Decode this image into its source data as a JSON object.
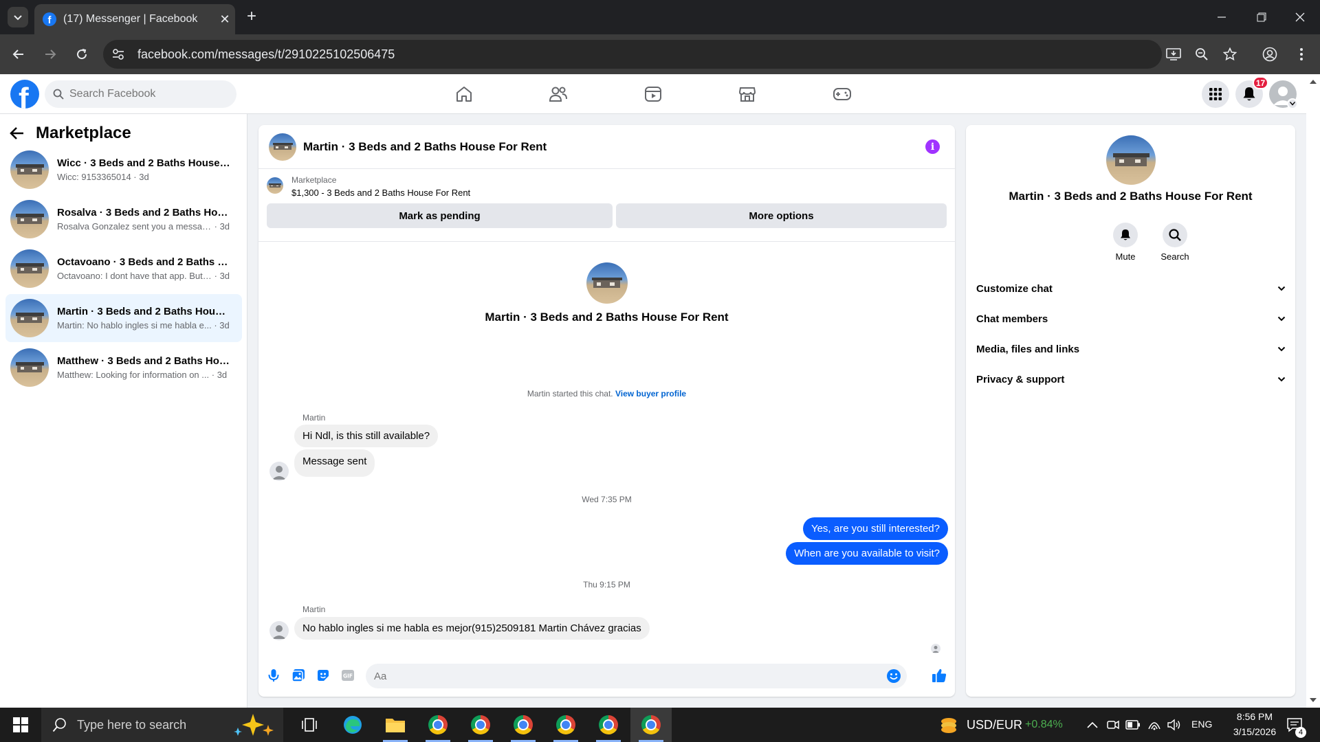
{
  "browser": {
    "tab_title": "(17) Messenger | Facebook",
    "url": "facebook.com/messages/t/2910225102506475"
  },
  "header": {
    "search_placeholder": "Search Facebook",
    "notification_count": "17"
  },
  "sidebar": {
    "title": "Marketplace",
    "conversations": [
      {
        "name": "Wicc · 3 Beds and 2 Baths House F...",
        "preview": "Wicc: 9153365014",
        "time": "3d",
        "active": false
      },
      {
        "name": "Rosalva · 3 Beds and 2 Baths Hous...",
        "preview": "Rosalva Gonzalez sent you a message...",
        "time": "3d",
        "active": false
      },
      {
        "name": "Octavoano · 3 Beds and 2 Baths H...",
        "preview": "Octavoano: I dont have that app. But ...",
        "time": "3d",
        "active": false
      },
      {
        "name": "Martin · 3 Beds and 2 Baths House...",
        "preview": "Martin: No hablo ingles si me habla e...",
        "time": "3d",
        "active": true
      },
      {
        "name": "Matthew · 3 Beds and 2 Baths Hou...",
        "preview": "Matthew: Looking for information on ...",
        "time": "3d",
        "active": false
      }
    ]
  },
  "chat": {
    "title": "Martin · 3 Beds and 2 Baths House For Rent",
    "marketplace_label": "Marketplace",
    "listing": "$1,300 - 3 Beds and 2 Baths House For Rent",
    "mark_pending": "Mark as pending",
    "more_options": "More options",
    "started_text": "Martin started this chat.",
    "view_profile": "View buyer profile",
    "sender1": "Martin",
    "msg1": "Hi Ndl, is this still available?",
    "msg2": "Message sent",
    "ts1": "Wed 7:35 PM",
    "out1": "Yes, are you still interested?",
    "out2": "When are you available to visit?",
    "ts2": "Thu 9:15 PM",
    "sender2": "Martin",
    "msg3": "No hablo ingles si me habla es mejor(915)2509181 Martin Chávez gracias",
    "composer_placeholder": "Aa"
  },
  "details": {
    "title": "Martin · 3 Beds and 2 Baths House For Rent",
    "mute": "Mute",
    "search": "Search",
    "sections": [
      "Customize chat",
      "Chat members",
      "Media, files and links",
      "Privacy & support"
    ]
  },
  "taskbar": {
    "search_placeholder": "Type here to search",
    "currency": "USD/EUR",
    "currency_change": "+0.84%",
    "lang": "ENG",
    "time": "8:56 PM",
    "date": "3/15/2026",
    "notif_count": "4"
  },
  "colors": {
    "fb_blue": "#1877f2",
    "bubble_out": "#0a5dff",
    "info_purple": "#a033ff",
    "badge_red": "#e41e3f",
    "positive_green": "#4caf50"
  }
}
